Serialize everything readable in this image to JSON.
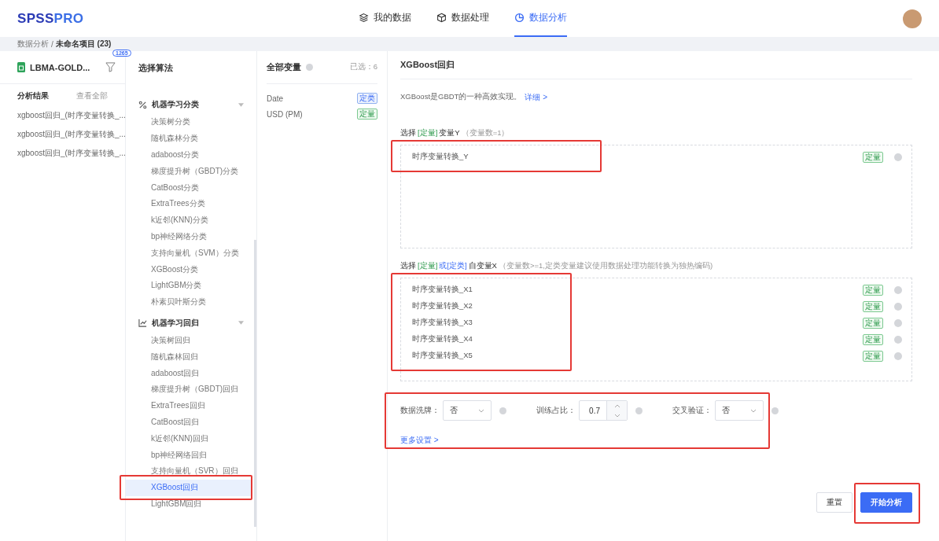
{
  "header": {
    "logo": [
      {
        "text": "SPSS",
        "kind": "dark"
      },
      {
        "text": "PRO",
        "kind": "light"
      }
    ],
    "nav": [
      {
        "label": "我的数据",
        "selected": false
      },
      {
        "label": "数据处理",
        "selected": false
      },
      {
        "label": "数据分析",
        "selected": true
      }
    ]
  },
  "breadcrumb": {
    "parent": "数据分析",
    "separator": "/",
    "current": "未命名项目 (23)"
  },
  "file_panel": {
    "file_name": "LBMA-GOLD...",
    "badge": "1265",
    "results_title": "分析结果",
    "view_all": "查看全部",
    "results": [
      "xgboost回归_(时序变量转换_...",
      "xgboost回归_(时序变量转换_...",
      "xgboost回归_(时序变量转换_..."
    ]
  },
  "algorithm_panel": {
    "title": "选择算法",
    "categories": [
      {
        "label": "机器学习分类",
        "expanded": true,
        "children": [
          {
            "label": "决策树分类",
            "selected": false,
            "highlighted": false
          },
          {
            "label": "随机森林分类",
            "selected": false,
            "highlighted": false
          },
          {
            "label": "adaboost分类",
            "selected": false,
            "highlighted": false
          },
          {
            "label": "梯度提升树（GBDT)分类",
            "selected": false,
            "highlighted": false
          },
          {
            "label": "CatBoost分类",
            "selected": false,
            "highlighted": false
          },
          {
            "label": "ExtraTrees分类",
            "selected": false,
            "highlighted": false
          },
          {
            "label": "k近邻(KNN)分类",
            "selected": false,
            "highlighted": false
          },
          {
            "label": "bp神经网络分类",
            "selected": false,
            "highlighted": false
          },
          {
            "label": "支持向量机（SVM）分类",
            "selected": false,
            "highlighted": false
          },
          {
            "label": "XGBoost分类",
            "selected": false,
            "highlighted": false
          },
          {
            "label": "LightGBM分类",
            "selected": false,
            "highlighted": false
          },
          {
            "label": "朴素贝叶斯分类",
            "selected": false,
            "highlighted": false
          }
        ]
      },
      {
        "label": "机器学习回归",
        "expanded": true,
        "children": [
          {
            "label": "决策树回归",
            "selected": false,
            "highlighted": false
          },
          {
            "label": "随机森林回归",
            "selected": false,
            "highlighted": false
          },
          {
            "label": "adaboost回归",
            "selected": false,
            "highlighted": false
          },
          {
            "label": "梯度提升树（GBDT)回归",
            "selected": false,
            "highlighted": false
          },
          {
            "label": "ExtraTrees回归",
            "selected": false,
            "highlighted": false
          },
          {
            "label": "CatBoost回归",
            "selected": false,
            "highlighted": false
          },
          {
            "label": "k近邻(KNN)回归",
            "selected": false,
            "highlighted": false
          },
          {
            "label": "bp神经网络回归",
            "selected": false,
            "highlighted": false
          },
          {
            "label": "支持向量机（SVR）回归",
            "selected": false,
            "highlighted": false
          },
          {
            "label": "XGBoost回归",
            "selected": true,
            "highlighted": true
          },
          {
            "label": "LightGBM回归",
            "selected": false,
            "highlighted": false
          }
        ]
      }
    ]
  },
  "variables_panel": {
    "title": "全部变量",
    "selected_count": "已选：6",
    "variables": [
      {
        "name": "Date",
        "tag": "定类",
        "kind": "categorical"
      },
      {
        "name": "USD (PM)",
        "tag": "定量",
        "kind": "quantitative"
      }
    ]
  },
  "main": {
    "title": "XGBoost回归",
    "description": "XGBoost是GBDT的一种高效实现。",
    "detail_link": "详细 >",
    "y_label": [
      {
        "text": "选择",
        "kind": "plain"
      },
      {
        "text": "[定量]",
        "kind": "quantitative"
      },
      {
        "text": "变量Y",
        "kind": "plain"
      },
      {
        "text": "（变量数=1）",
        "kind": "hint"
      }
    ],
    "y_variables": {
      "highlighted": true,
      "items": [
        {
          "name": "时序变量转换_Y",
          "tag": "定量",
          "kind": "quantitative"
        }
      ]
    },
    "x_label": [
      {
        "text": "选择",
        "kind": "plain"
      },
      {
        "text": "[定量]",
        "kind": "quantitative"
      },
      {
        "text": "或[定类]",
        "kind": "categorical"
      },
      {
        "text": "自变量X",
        "kind": "plain"
      },
      {
        "text": "（变量数>=1,定类变量建议使用数据处理功能转换为独热编码)",
        "kind": "hint"
      }
    ],
    "x_variables": {
      "highlighted": true,
      "items": [
        {
          "name": "时序变量转换_X1",
          "tag": "定量",
          "kind": "quantitative"
        },
        {
          "name": "时序变量转换_X2",
          "tag": "定量",
          "kind": "quantitative"
        },
        {
          "name": "时序变量转换_X3",
          "tag": "定量",
          "kind": "quantitative"
        },
        {
          "name": "时序变量转换_X4",
          "tag": "定量",
          "kind": "quantitative"
        },
        {
          "name": "时序变量转换_X5",
          "tag": "定量",
          "kind": "quantitative"
        }
      ]
    },
    "settings": {
      "highlighted": true,
      "fields": [
        {
          "label": "数据洗牌：",
          "kind": "select",
          "value": "否"
        },
        {
          "label": "训练占比：",
          "kind": "number",
          "value": "0.7"
        },
        {
          "label": "交叉验证：",
          "kind": "select",
          "value": "否"
        }
      ],
      "more": "更多设置 >"
    },
    "buttons": [
      {
        "label": "重置",
        "kind": "secondary",
        "highlighted": false
      },
      {
        "label": "开始分析",
        "kind": "primary",
        "highlighted": true
      }
    ]
  }
}
